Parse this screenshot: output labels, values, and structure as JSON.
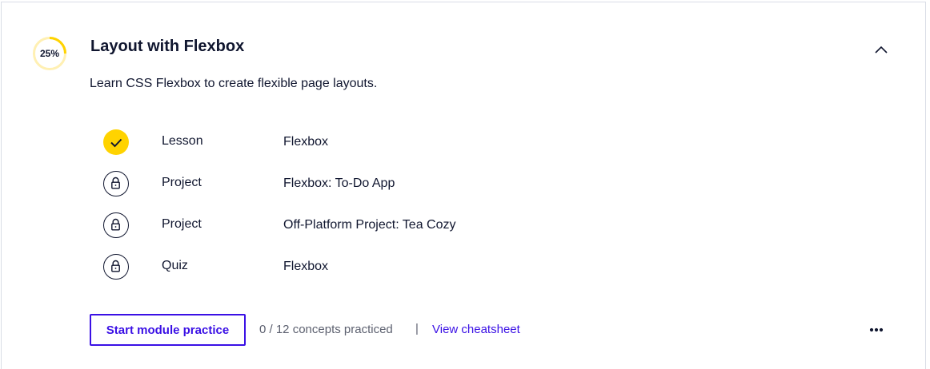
{
  "module": {
    "progress_label": "25%",
    "progress_fraction": 0.25,
    "title": "Layout with Flexbox",
    "description": "Learn CSS Flexbox to create flexible page layouts.",
    "collapse_icon": "chevron-up-icon"
  },
  "items": [
    {
      "type": "Lesson",
      "name": "Flexbox",
      "status": "completed",
      "icon": "checkmark-icon"
    },
    {
      "type": "Project",
      "name": "Flexbox: To-Do App",
      "status": "locked",
      "icon": "lock-icon"
    },
    {
      "type": "Project",
      "name": "Off-Platform Project: Tea Cozy",
      "status": "locked",
      "icon": "lock-icon"
    },
    {
      "type": "Quiz",
      "name": "Flexbox",
      "status": "locked",
      "icon": "lock-icon"
    }
  ],
  "footer": {
    "practice_button": "Start module practice",
    "concepts_text": "0 / 12 concepts practiced",
    "separator": "|",
    "cheatsheet_link": "View cheatsheet",
    "more_icon": "more-horizontal-icon"
  },
  "colors": {
    "accent": "#3a10e5",
    "progress": "#ffd300",
    "progress_track": "#fff0b3",
    "text": "#10162f",
    "muted": "#5d6170"
  }
}
